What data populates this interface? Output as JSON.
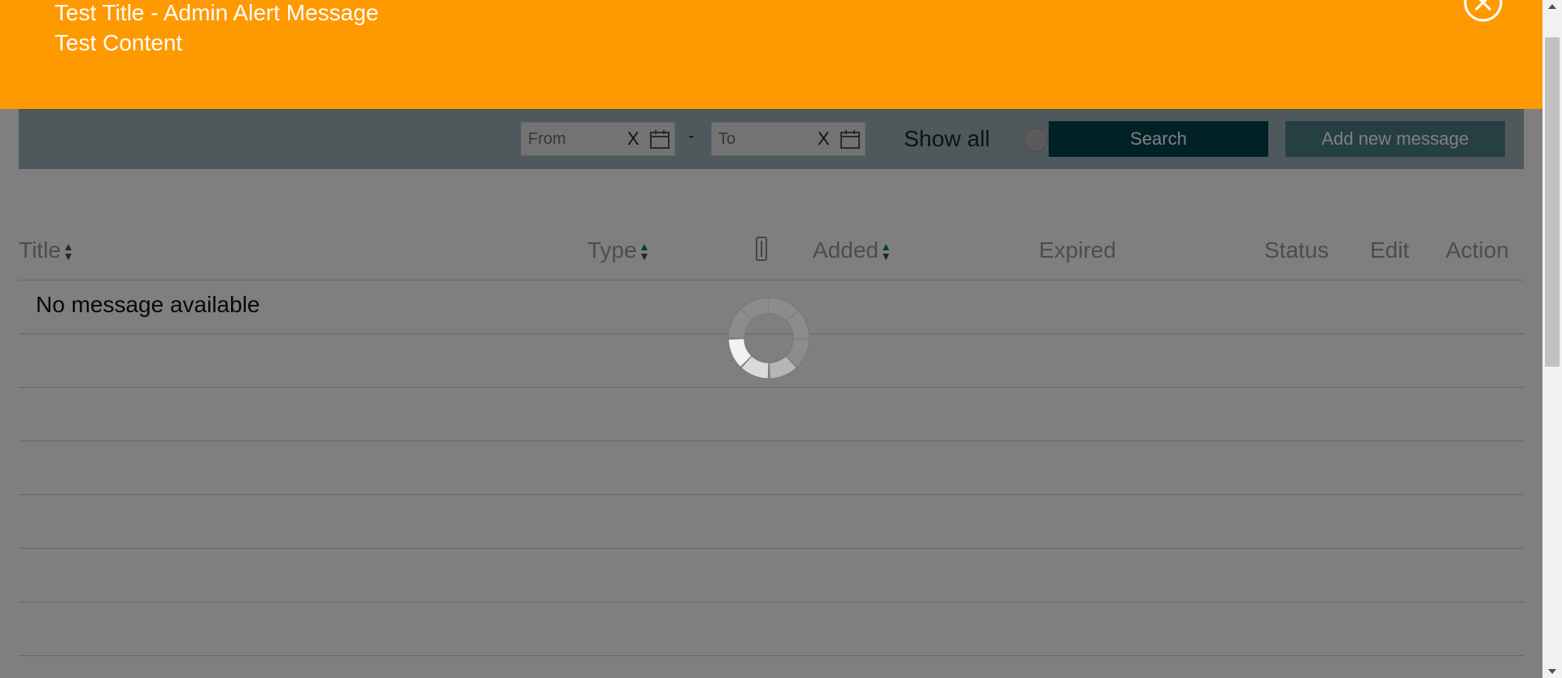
{
  "alert": {
    "title": "Test Title - Admin Alert Message",
    "content": "Test Content",
    "background_color": "#ff9900",
    "close_icon": "close-circle-icon"
  },
  "filters": {
    "from_placeholder": "From",
    "to_placeholder": "To",
    "clear_label": "X",
    "range_separator": "-",
    "calendar_icon": "calendar-icon",
    "show_all_label": "Show all",
    "show_all_enabled": false
  },
  "buttons": {
    "search_label": "Search",
    "add_label": "Add new message",
    "search_color": "#00454f",
    "add_color": "#4a7e86"
  },
  "table": {
    "columns": {
      "title": "Title",
      "type": "Type",
      "attachment_icon": "paperclip-icon",
      "added": "Added",
      "expired": "Expired",
      "status": "Status",
      "edit": "Edit",
      "action": "Action"
    },
    "empty_message": "No message available"
  },
  "loading": {
    "icon": "loading-spinner-icon"
  }
}
